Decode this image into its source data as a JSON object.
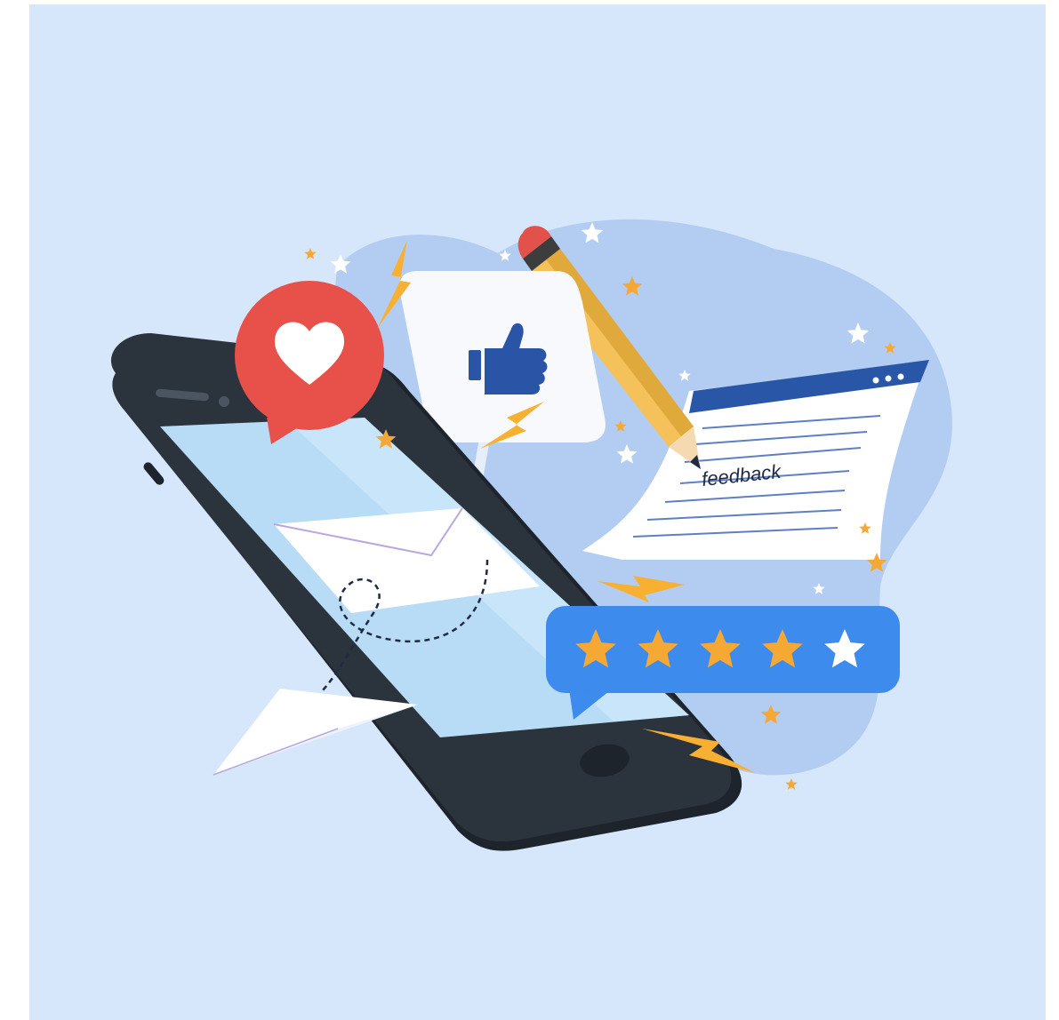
{
  "illustration": {
    "feedback_word": "feedback",
    "rating": {
      "filled": 4,
      "total": 5
    },
    "colors": {
      "background": "#d6e6fb",
      "blob": "#b3cdf2",
      "phone_body": "#2b333c",
      "phone_screen": "#b8dcf6",
      "heart_bubble": "#e8504a",
      "like_blue": "#2a54a6",
      "rating_bubble": "#3d8bec",
      "star_gold": "#f6a834",
      "bolt": "#f7b031",
      "pencil_body": "#f4c15a",
      "eraser": "#e3514b",
      "doc_header": "#2a56a8"
    },
    "icons": [
      "heart-icon",
      "thumbs-up-icon",
      "pencil-icon",
      "envelope-icon",
      "paper-plane-icon",
      "star-icon",
      "lightning-bolt-icon"
    ]
  }
}
